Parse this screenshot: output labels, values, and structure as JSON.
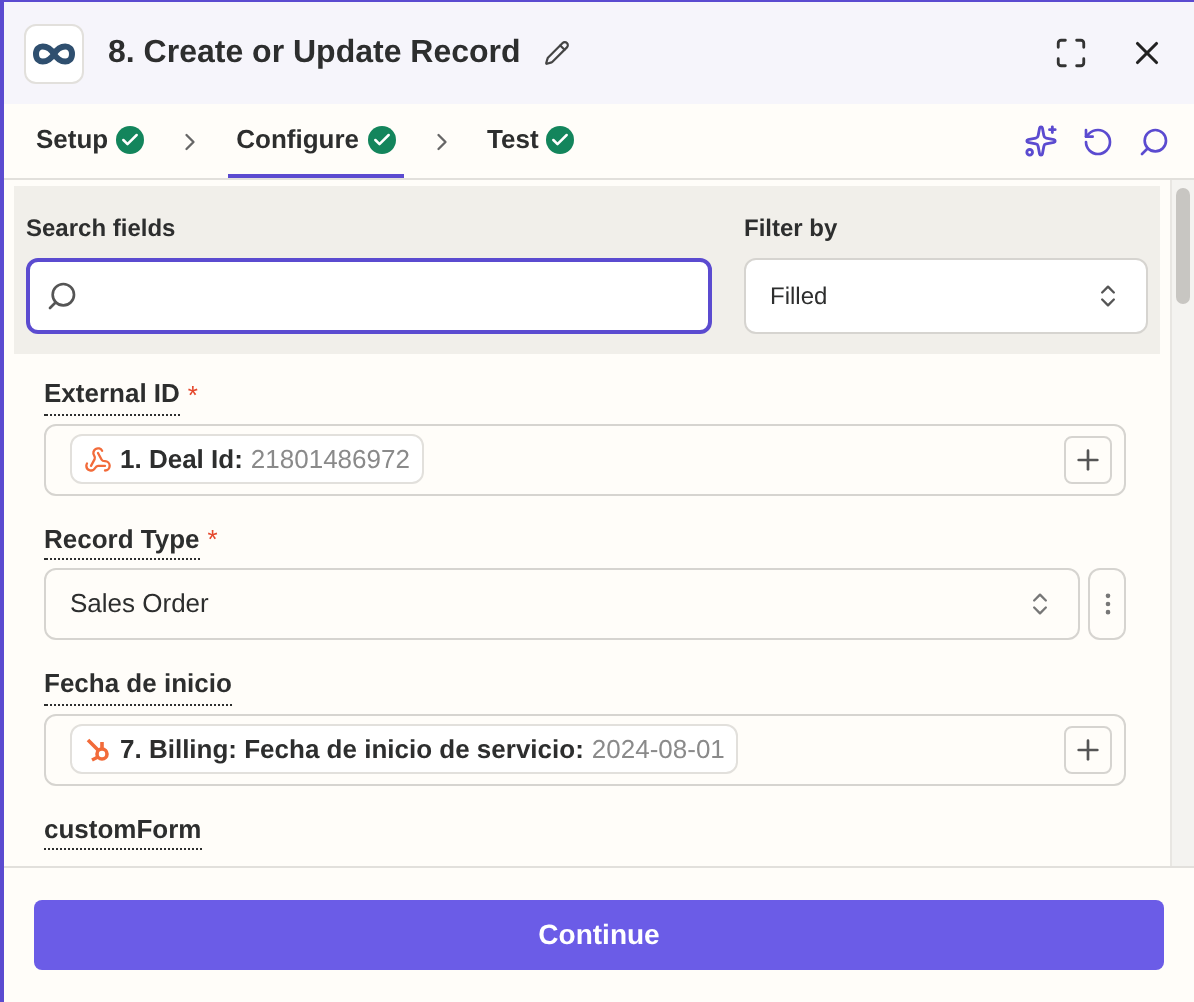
{
  "header": {
    "title": "8. Create or Update Record"
  },
  "steps": [
    {
      "label": "Setup",
      "done": true,
      "selected": false
    },
    {
      "label": "Configure",
      "done": true,
      "selected": true
    },
    {
      "label": "Test",
      "done": true,
      "selected": false
    }
  ],
  "search": {
    "label": "Search fields"
  },
  "filter": {
    "label": "Filter by",
    "value": "Filled"
  },
  "fields": [
    {
      "kind": "mapped",
      "label": "External ID",
      "required_mark": "*",
      "chips": [
        {
          "kind": "webhook",
          "label": "1. Deal Id:",
          "value": "21801486972"
        }
      ]
    },
    {
      "kind": "select",
      "label": "Record Type",
      "required_mark": "*",
      "value": "Sales Order"
    },
    {
      "kind": "mapped",
      "label": "Fecha de inicio",
      "chips": [
        {
          "kind": "hubspot",
          "label": "7. Billing: Fecha de inicio de servicio:",
          "value": "2024-08-01"
        }
      ]
    },
    {
      "kind": "cut",
      "label": "customForm"
    }
  ],
  "footer": {
    "button": "Continue"
  }
}
